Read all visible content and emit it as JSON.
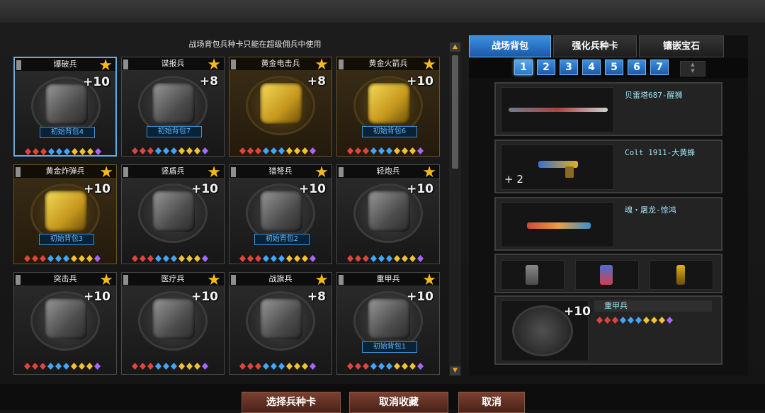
{
  "notice": "战场背包兵种卡只能在超级佣兵中使用",
  "cards": [
    {
      "name": "爆破兵",
      "bonus": "+10",
      "pack": "初始背包4",
      "gold": false,
      "selected": true
    },
    {
      "name": "谍报兵",
      "bonus": "+8",
      "pack": "初始背包7",
      "gold": false,
      "selected": false
    },
    {
      "name": "黄金电击兵",
      "bonus": "+8",
      "pack": "",
      "gold": true,
      "selected": false
    },
    {
      "name": "黄金火箭兵",
      "bonus": "+10",
      "pack": "初始背包6",
      "gold": true,
      "selected": false
    },
    {
      "name": "黄金炸弹兵",
      "bonus": "+10",
      "pack": "初始背包3",
      "gold": true,
      "selected": false
    },
    {
      "name": "竖盾兵",
      "bonus": "+10",
      "pack": "",
      "gold": false,
      "selected": false
    },
    {
      "name": "猎弩兵",
      "bonus": "+10",
      "pack": "初始背包2",
      "gold": false,
      "selected": false
    },
    {
      "name": "轻炮兵",
      "bonus": "+10",
      "pack": "",
      "gold": false,
      "selected": false
    },
    {
      "name": "突击兵",
      "bonus": "+10",
      "pack": "",
      "gold": false,
      "selected": false
    },
    {
      "name": "医疗兵",
      "bonus": "+10",
      "pack": "",
      "gold": false,
      "selected": false
    },
    {
      "name": "战旗兵",
      "bonus": "+8",
      "pack": "",
      "gold": false,
      "selected": false
    },
    {
      "name": "重甲兵",
      "bonus": "+10",
      "pack": "初始背包1",
      "gold": false,
      "selected": false
    }
  ],
  "gem_colors": [
    "#e0443a",
    "#e0443a",
    "#e0443a",
    "#3fa7ff",
    "#3fa7ff",
    "#3fa7ff",
    "#f2c231",
    "#f2c231",
    "#f2c231",
    "#a866ff"
  ],
  "tabs": [
    {
      "label": "战场背包",
      "active": true
    },
    {
      "label": "强化兵种卡",
      "active": false
    },
    {
      "label": "镶嵌宝石",
      "active": false
    }
  ],
  "pages": [
    "1",
    "2",
    "3",
    "4",
    "5",
    "6",
    "7"
  ],
  "active_page": "1",
  "loadout": {
    "primary_weapon": "贝雷塔687-醒狮",
    "secondary_weapon": "Colt 1911-大黄蜂",
    "secondary_ammo_count": "+ 2",
    "melee_weapon": "魂・屠龙-惊鸿",
    "merc_name": "重甲兵",
    "merc_bonus": "+10"
  },
  "buttons": {
    "select_card": "选择兵种卡",
    "unfavorite": "取消收藏",
    "cancel": "取消"
  }
}
